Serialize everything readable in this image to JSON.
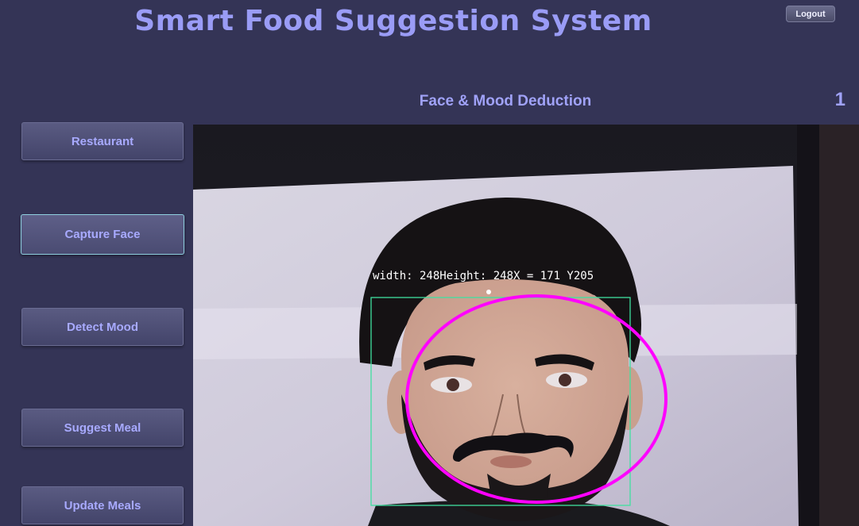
{
  "app": {
    "title": "Smart Food Suggestion System",
    "logout_label": "Logout"
  },
  "section": {
    "title": "Face & Mood Deduction",
    "counter": "1"
  },
  "sidebar": {
    "items": [
      {
        "label": "Restaurant"
      },
      {
        "label": "Capture Face"
      },
      {
        "label": "Detect Mood"
      },
      {
        "label": "Suggest Meal"
      },
      {
        "label": "Update Meals"
      }
    ]
  },
  "camera": {
    "overlay_text": "width: 248Height: 248X = 171 Y205",
    "box_color": "#40e0a0",
    "ellipse_color": "#ff00ff"
  },
  "colors": {
    "background": "#343456",
    "accent_text": "#9a9cf6"
  }
}
